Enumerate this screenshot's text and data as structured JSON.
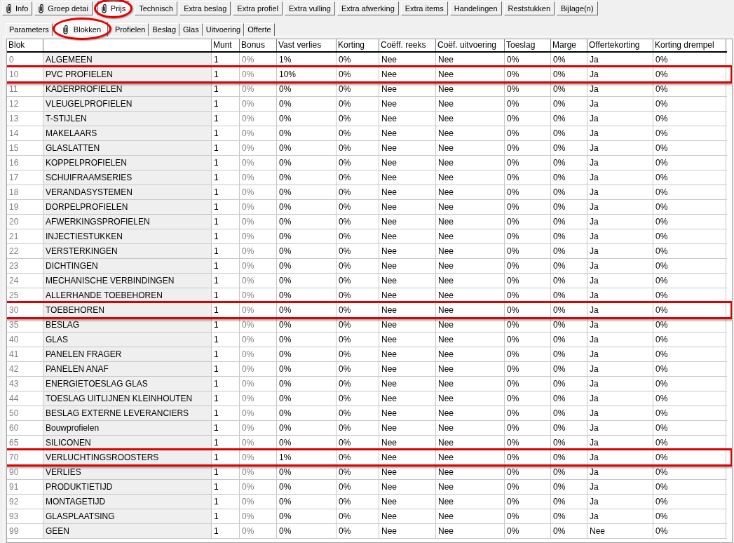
{
  "toolbar": {
    "buttons": [
      {
        "label": "Info",
        "attachment": true,
        "selected": false,
        "annotated": false
      },
      {
        "label": "Groep detai",
        "attachment": true,
        "selected": false,
        "annotated": false
      },
      {
        "label": "Prijs",
        "attachment": true,
        "selected": true,
        "annotated": true
      },
      {
        "label": "Technisch",
        "attachment": false,
        "selected": false,
        "annotated": false
      },
      {
        "label": "Extra beslag",
        "attachment": false,
        "selected": false,
        "annotated": false
      },
      {
        "label": "Extra profiel",
        "attachment": false,
        "selected": false,
        "annotated": false
      },
      {
        "label": "Extra vulling",
        "attachment": false,
        "selected": false,
        "annotated": false
      },
      {
        "label": "Extra afwerking",
        "attachment": false,
        "selected": false,
        "annotated": false
      },
      {
        "label": "Extra items",
        "attachment": false,
        "selected": false,
        "annotated": false
      },
      {
        "label": "Handelingen",
        "attachment": false,
        "selected": false,
        "annotated": false
      },
      {
        "label": "Reststukken",
        "attachment": false,
        "selected": false,
        "annotated": false
      },
      {
        "label": "Bijlage(n)",
        "attachment": false,
        "selected": false,
        "annotated": false
      }
    ]
  },
  "tabs": [
    {
      "label": "Parameters",
      "attachment": false,
      "selected": false,
      "annotated": false
    },
    {
      "label": "Blokken",
      "attachment": true,
      "selected": true,
      "annotated": true
    },
    {
      "label": "Profielen",
      "attachment": false,
      "selected": false,
      "annotated": false
    },
    {
      "label": "Beslag",
      "attachment": false,
      "selected": false,
      "annotated": false
    },
    {
      "label": "Glas",
      "attachment": false,
      "selected": false,
      "annotated": false
    },
    {
      "label": "Uitvoering",
      "attachment": false,
      "selected": false,
      "annotated": false
    },
    {
      "label": "Offerte",
      "attachment": false,
      "selected": false,
      "annotated": false
    }
  ],
  "table": {
    "columns": [
      {
        "label": "Blok",
        "disabled": true,
        "shaded": false
      },
      {
        "disabled": false,
        "shaded": true
      },
      {
        "label": "Munt",
        "disabled": false,
        "shaded": false
      },
      {
        "label": "Bonus",
        "disabled": true,
        "shaded": false
      },
      {
        "label": "Vast verlies",
        "disabled": false,
        "shaded": false
      },
      {
        "label": "Korting",
        "disabled": false,
        "shaded": false
      },
      {
        "label": "Coëff. reeks",
        "disabled": false,
        "shaded": false
      },
      {
        "label": "Coëf. uitvoering",
        "disabled": false,
        "shaded": false
      },
      {
        "label": "Toeslag",
        "disabled": false,
        "shaded": false
      },
      {
        "label": "Marge",
        "disabled": false,
        "shaded": false
      },
      {
        "label": "Offertekorting",
        "disabled": false,
        "shaded": false
      },
      {
        "label": "Korting drempel",
        "disabled": false,
        "shaded": false
      }
    ],
    "rows": [
      {
        "cells": [
          "0",
          "ALGEMEEN",
          "1",
          "0%",
          "1%",
          "0%",
          "Nee",
          "Nee",
          "0%",
          "0%",
          "Ja",
          "0%"
        ],
        "annotated": false
      },
      {
        "cells": [
          "10",
          "PVC PROFIELEN",
          "1",
          "0%",
          "10%",
          "0%",
          "Nee",
          "Nee",
          "0%",
          "0%",
          "Ja",
          "0%"
        ],
        "annotated": true
      },
      {
        "cells": [
          "11",
          "KADERPROFIELEN",
          "1",
          "0%",
          "0%",
          "0%",
          "Nee",
          "Nee",
          "0%",
          "0%",
          "Ja",
          "0%"
        ],
        "annotated": false
      },
      {
        "cells": [
          "12",
          "VLEUGELPROFIELEN",
          "1",
          "0%",
          "0%",
          "0%",
          "Nee",
          "Nee",
          "0%",
          "0%",
          "Ja",
          "0%"
        ],
        "annotated": false
      },
      {
        "cells": [
          "13",
          "T-STIJLEN",
          "1",
          "0%",
          "0%",
          "0%",
          "Nee",
          "Nee",
          "0%",
          "0%",
          "Ja",
          "0%"
        ],
        "annotated": false
      },
      {
        "cells": [
          "14",
          "MAKELAARS",
          "1",
          "0%",
          "0%",
          "0%",
          "Nee",
          "Nee",
          "0%",
          "0%",
          "Ja",
          "0%"
        ],
        "annotated": false
      },
      {
        "cells": [
          "15",
          "GLASLATTEN",
          "1",
          "0%",
          "0%",
          "0%",
          "Nee",
          "Nee",
          "0%",
          "0%",
          "Ja",
          "0%"
        ],
        "annotated": false
      },
      {
        "cells": [
          "16",
          "KOPPELPROFIELEN",
          "1",
          "0%",
          "0%",
          "0%",
          "Nee",
          "Nee",
          "0%",
          "0%",
          "Ja",
          "0%"
        ],
        "annotated": false
      },
      {
        "cells": [
          "17",
          "SCHUIFRAAMSERIES",
          "1",
          "0%",
          "0%",
          "0%",
          "Nee",
          "Nee",
          "0%",
          "0%",
          "Ja",
          "0%"
        ],
        "annotated": false
      },
      {
        "cells": [
          "18",
          "VERANDASYSTEMEN",
          "1",
          "0%",
          "0%",
          "0%",
          "Nee",
          "Nee",
          "0%",
          "0%",
          "Ja",
          "0%"
        ],
        "annotated": false
      },
      {
        "cells": [
          "19",
          "DORPELPROFIELEN",
          "1",
          "0%",
          "0%",
          "0%",
          "Nee",
          "Nee",
          "0%",
          "0%",
          "Ja",
          "0%"
        ],
        "annotated": false
      },
      {
        "cells": [
          "20",
          "AFWERKINGSPROFIELEN",
          "1",
          "0%",
          "0%",
          "0%",
          "Nee",
          "Nee",
          "0%",
          "0%",
          "Ja",
          "0%"
        ],
        "annotated": false
      },
      {
        "cells": [
          "21",
          "INJECTIESTUKKEN",
          "1",
          "0%",
          "0%",
          "0%",
          "Nee",
          "Nee",
          "0%",
          "0%",
          "Ja",
          "0%"
        ],
        "annotated": false
      },
      {
        "cells": [
          "22",
          "VERSTERKINGEN",
          "1",
          "0%",
          "0%",
          "0%",
          "Nee",
          "Nee",
          "0%",
          "0%",
          "Ja",
          "0%"
        ],
        "annotated": false
      },
      {
        "cells": [
          "23",
          "DICHTINGEN",
          "1",
          "0%",
          "0%",
          "0%",
          "Nee",
          "Nee",
          "0%",
          "0%",
          "Ja",
          "0%"
        ],
        "annotated": false
      },
      {
        "cells": [
          "24",
          "MECHANISCHE VERBINDINGEN",
          "1",
          "0%",
          "0%",
          "0%",
          "Nee",
          "Nee",
          "0%",
          "0%",
          "Ja",
          "0%"
        ],
        "annotated": false
      },
      {
        "cells": [
          "25",
          "ALLERHANDE TOEBEHOREN",
          "1",
          "0%",
          "0%",
          "0%",
          "Nee",
          "Nee",
          "0%",
          "0%",
          "Ja",
          "0%"
        ],
        "annotated": false
      },
      {
        "cells": [
          "30",
          "TOEBEHOREN",
          "1",
          "0%",
          "0%",
          "0%",
          "Nee",
          "Nee",
          "0%",
          "0%",
          "Ja",
          "0%"
        ],
        "annotated": true
      },
      {
        "cells": [
          "35",
          "BESLAG",
          "1",
          "0%",
          "0%",
          "0%",
          "Nee",
          "Nee",
          "0%",
          "0%",
          "Ja",
          "0%"
        ],
        "annotated": false
      },
      {
        "cells": [
          "40",
          "GLAS",
          "1",
          "0%",
          "0%",
          "0%",
          "Nee",
          "Nee",
          "0%",
          "0%",
          "Ja",
          "0%"
        ],
        "annotated": false
      },
      {
        "cells": [
          "41",
          "PANELEN FRAGER",
          "1",
          "0%",
          "0%",
          "0%",
          "Nee",
          "Nee",
          "0%",
          "0%",
          "Ja",
          "0%"
        ],
        "annotated": false
      },
      {
        "cells": [
          "42",
          "PANELEN ANAF",
          "1",
          "0%",
          "0%",
          "0%",
          "Nee",
          "Nee",
          "0%",
          "0%",
          "Ja",
          "0%"
        ],
        "annotated": false
      },
      {
        "cells": [
          "43",
          "ENERGIETOESLAG GLAS",
          "1",
          "0%",
          "0%",
          "0%",
          "Nee",
          "Nee",
          "0%",
          "0%",
          "Ja",
          "0%"
        ],
        "annotated": false
      },
      {
        "cells": [
          "44",
          "TOESLAG UITLIJNEN KLEINHOUTEN",
          "1",
          "0%",
          "0%",
          "0%",
          "Nee",
          "Nee",
          "0%",
          "0%",
          "Ja",
          "0%"
        ],
        "annotated": false
      },
      {
        "cells": [
          "50",
          "BESLAG EXTERNE LEVERANCIERS",
          "1",
          "0%",
          "0%",
          "0%",
          "Nee",
          "Nee",
          "0%",
          "0%",
          "Ja",
          "0%"
        ],
        "annotated": false
      },
      {
        "cells": [
          "60",
          "Bouwprofielen",
          "1",
          "0%",
          "0%",
          "0%",
          "Nee",
          "Nee",
          "0%",
          "0%",
          "Ja",
          "0%"
        ],
        "annotated": false
      },
      {
        "cells": [
          "65",
          "SILICONEN",
          "1",
          "0%",
          "0%",
          "0%",
          "Nee",
          "Nee",
          "0%",
          "0%",
          "Ja",
          "0%"
        ],
        "annotated": false
      },
      {
        "cells": [
          "70",
          "VERLUCHTINGSROOSTERS",
          "1",
          "0%",
          "1%",
          "0%",
          "Nee",
          "Nee",
          "0%",
          "0%",
          "Ja",
          "0%"
        ],
        "annotated": true
      },
      {
        "cells": [
          "90",
          "VERLIES",
          "1",
          "0%",
          "0%",
          "0%",
          "Nee",
          "Nee",
          "0%",
          "0%",
          "Ja",
          "0%"
        ],
        "annotated": false
      },
      {
        "cells": [
          "91",
          "PRODUKTIETIJD",
          "1",
          "0%",
          "0%",
          "0%",
          "Nee",
          "Nee",
          "0%",
          "0%",
          "Ja",
          "0%"
        ],
        "annotated": false
      },
      {
        "cells": [
          "92",
          "MONTAGETIJD",
          "1",
          "0%",
          "0%",
          "0%",
          "Nee",
          "Nee",
          "0%",
          "0%",
          "Ja",
          "0%"
        ],
        "annotated": false
      },
      {
        "cells": [
          "93",
          "GLASPLAATSING",
          "1",
          "0%",
          "0%",
          "0%",
          "Nee",
          "Nee",
          "0%",
          "0%",
          "Ja",
          "0%"
        ],
        "annotated": false
      },
      {
        "cells": [
          "99",
          "GEEN",
          "1",
          "0%",
          "0%",
          "0%",
          "Nee",
          "Nee",
          "0%",
          "0%",
          "Nee",
          "0%"
        ],
        "annotated": false
      }
    ]
  }
}
